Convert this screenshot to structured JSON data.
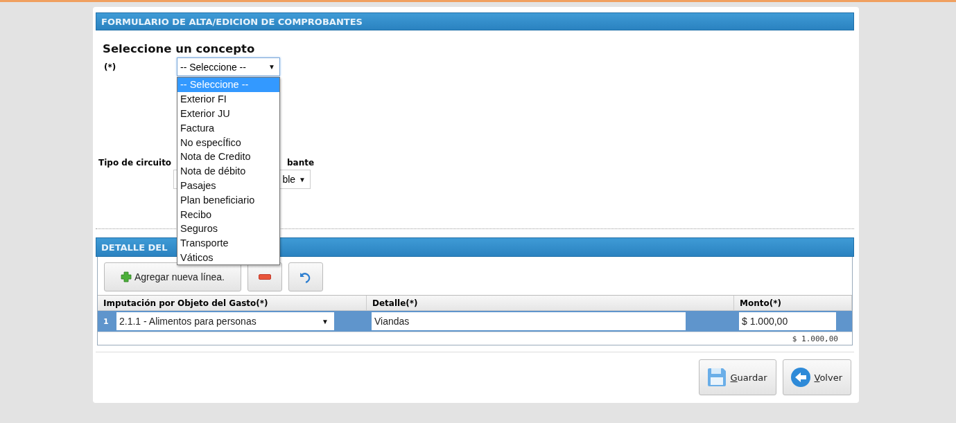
{
  "header": {
    "title": "FORMULARIO DE ALTA/EDICION DE COMPROBANTES"
  },
  "concept": {
    "heading": "Seleccione un concepto",
    "required_mark": "(*)",
    "select_value": "-- Seleccione --",
    "caret": "▼",
    "options": [
      {
        "label": "-- Seleccione --",
        "selected": true
      },
      {
        "label": "Exterior FI",
        "selected": false
      },
      {
        "label": "Exterior JU",
        "selected": false
      },
      {
        "label": "Factura",
        "selected": false
      },
      {
        "label": "No especÍfico",
        "selected": false
      },
      {
        "label": "Nota de Credito",
        "selected": false
      },
      {
        "label": "Nota de débito",
        "selected": false
      },
      {
        "label": "Pasajes",
        "selected": false
      },
      {
        "label": "Plan beneficiario",
        "selected": false
      },
      {
        "label": "Recibo",
        "selected": false
      },
      {
        "label": "Seguros",
        "selected": false
      },
      {
        "label": "Transporte",
        "selected": false
      },
      {
        "label": "Váticos",
        "selected": false
      }
    ]
  },
  "circuit": {
    "label": "Tipo de circuito",
    "label_2": "bante",
    "select_value": "ble",
    "caret": "▼"
  },
  "detail": {
    "title": "DETALLE DEL",
    "add_label": "Agregar nueva línea.",
    "columns": [
      "Imputación por Objeto del Gasto(*)",
      "Detalle(*)",
      "Monto(*)"
    ],
    "rows": [
      {
        "number": "1",
        "imputation": "2.1.1 - Alimentos para personas",
        "caret": "▼",
        "detalle": "Viandas",
        "monto": "$ 1.000,00",
        "selected": true
      }
    ],
    "total": "$ 1.000,00"
  },
  "buttons": [
    {
      "kind": "save",
      "label": "Guardar"
    },
    {
      "kind": "back",
      "label": "Volver"
    }
  ]
}
